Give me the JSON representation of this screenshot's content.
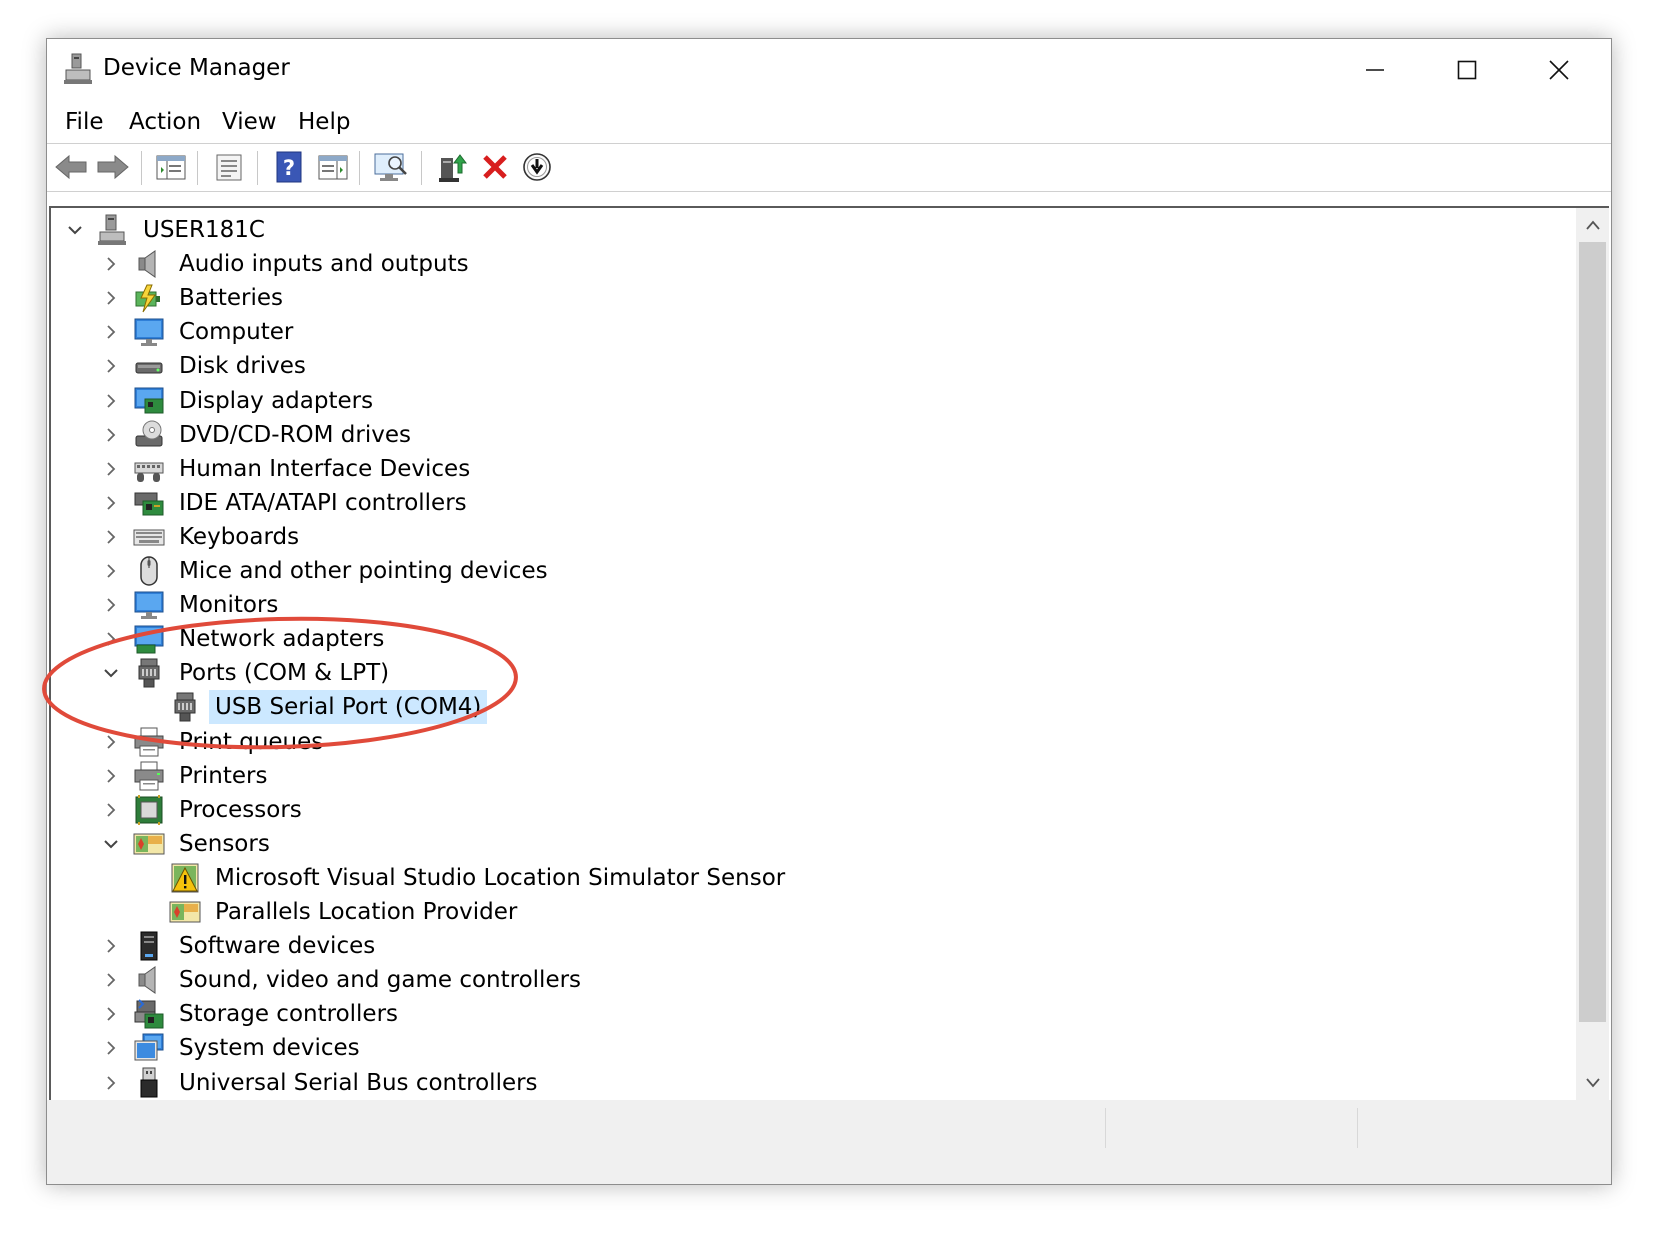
{
  "window": {
    "title": "Device Manager"
  },
  "title_controls": {
    "minimize": "minimize",
    "maximize": "maximize",
    "close": "close"
  },
  "menu": [
    {
      "label": "File"
    },
    {
      "label": "Action"
    },
    {
      "label": "View"
    },
    {
      "label": "Help"
    }
  ],
  "toolbar": [
    {
      "icon": "back-arrow-icon"
    },
    {
      "icon": "forward-arrow-icon"
    },
    {
      "icon": "show-hide-console-tree-icon"
    },
    {
      "icon": "properties-icon"
    },
    {
      "icon": "help-icon"
    },
    {
      "icon": "show-action-pane-icon"
    },
    {
      "icon": "scan-hardware-changes-icon"
    },
    {
      "icon": "update-driver-icon"
    },
    {
      "icon": "uninstall-device-icon"
    },
    {
      "icon": "disable-device-icon"
    }
  ],
  "tree": {
    "root": {
      "label": "USER181C",
      "icon": "computer-tower-icon",
      "expanded": true
    },
    "items": [
      {
        "label": "Audio inputs and outputs",
        "icon": "speaker-icon",
        "expanded": false,
        "level": 1
      },
      {
        "label": "Batteries",
        "icon": "battery-icon",
        "expanded": false,
        "level": 1
      },
      {
        "label": "Computer",
        "icon": "monitor-icon",
        "expanded": false,
        "level": 1
      },
      {
        "label": "Disk drives",
        "icon": "disk-drive-icon",
        "expanded": false,
        "level": 1
      },
      {
        "label": "Display adapters",
        "icon": "display-adapter-icon",
        "expanded": false,
        "level": 1
      },
      {
        "label": "DVD/CD-ROM drives",
        "icon": "optical-drive-icon",
        "expanded": false,
        "level": 1
      },
      {
        "label": "Human Interface Devices",
        "icon": "hid-icon",
        "expanded": false,
        "level": 1
      },
      {
        "label": "IDE ATA/ATAPI controllers",
        "icon": "ide-controller-icon",
        "expanded": false,
        "level": 1
      },
      {
        "label": "Keyboards",
        "icon": "keyboard-icon",
        "expanded": false,
        "level": 1
      },
      {
        "label": "Mice and other pointing devices",
        "icon": "mouse-icon",
        "expanded": false,
        "level": 1
      },
      {
        "label": "Monitors",
        "icon": "monitor-icon",
        "expanded": false,
        "level": 1
      },
      {
        "label": "Network adapters",
        "icon": "network-adapter-icon",
        "expanded": false,
        "level": 1
      },
      {
        "label": "Ports (COM & LPT)",
        "icon": "port-connector-icon",
        "expanded": true,
        "level": 1
      },
      {
        "label": "USB Serial Port (COM4)",
        "icon": "port-connector-icon",
        "level": 2,
        "selected": true
      },
      {
        "label": "Print queues",
        "icon": "printer-icon",
        "expanded": false,
        "level": 1
      },
      {
        "label": "Printers",
        "icon": "printer-icon",
        "expanded": false,
        "level": 1
      },
      {
        "label": "Processors",
        "icon": "processor-icon",
        "expanded": false,
        "level": 1
      },
      {
        "label": "Sensors",
        "icon": "sensor-icon",
        "expanded": true,
        "level": 1
      },
      {
        "label": "Microsoft Visual Studio Location Simulator Sensor",
        "icon": "sensor-warning-icon",
        "level": 2
      },
      {
        "label": "Parallels Location Provider",
        "icon": "sensor-icon",
        "level": 2
      },
      {
        "label": "Software devices",
        "icon": "software-device-icon",
        "expanded": false,
        "level": 1
      },
      {
        "label": "Sound, video and game controllers",
        "icon": "speaker-icon",
        "expanded": false,
        "level": 1
      },
      {
        "label": "Storage controllers",
        "icon": "storage-controller-icon",
        "expanded": false,
        "level": 1
      },
      {
        "label": "System devices",
        "icon": "system-devices-icon",
        "expanded": false,
        "level": 1
      },
      {
        "label": "Universal Serial Bus controllers",
        "icon": "usb-icon",
        "expanded": false,
        "level": 1
      }
    ]
  },
  "annotation": {
    "shape": "ellipse",
    "color": "#e04a3a",
    "highlights": "USB Serial Port (COM4)"
  },
  "colors": {
    "selection": "#cce8ff",
    "annotation": "#e04a3a"
  }
}
